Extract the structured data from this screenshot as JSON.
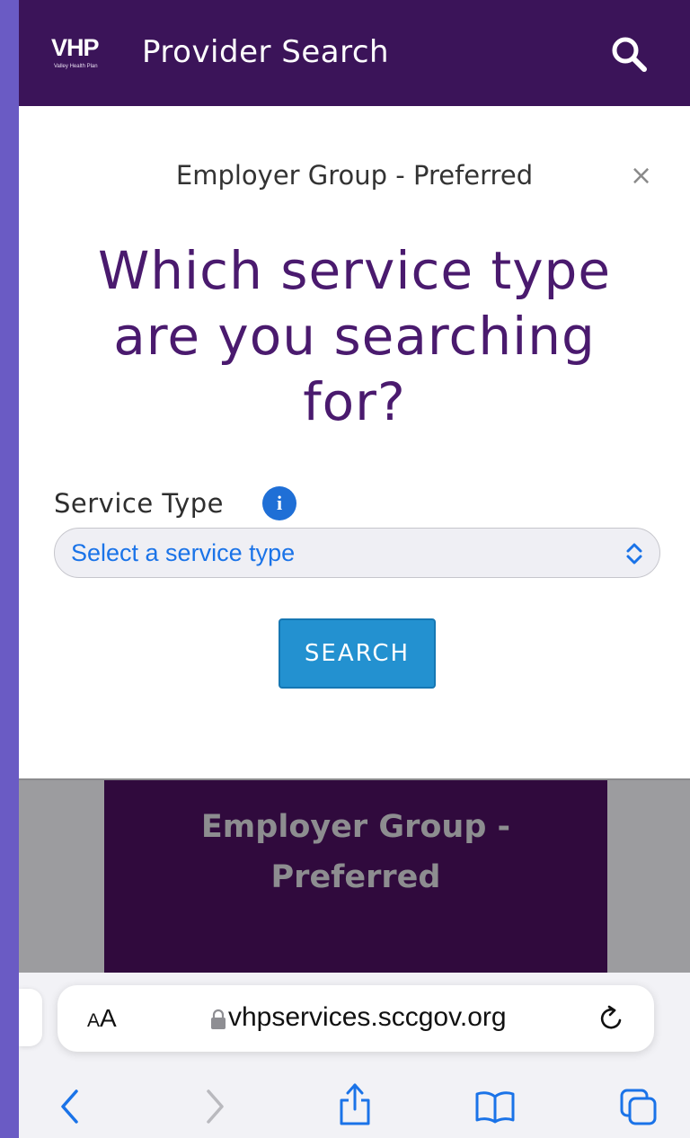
{
  "header": {
    "logo_text": "VHP",
    "logo_subtext": "Valley Health Plan",
    "title": "Provider Search"
  },
  "modal": {
    "subtitle": "Employer Group - Preferred",
    "close_glyph": "×",
    "question": "Which service type are you searching for?",
    "field_label": "Service Type",
    "info_glyph": "i",
    "select_placeholder": "Select a service type",
    "search_label": "SEARCH"
  },
  "background_banner": {
    "line1": "Employer Group -",
    "line2": "Preferred"
  },
  "browser": {
    "aa_small": "A",
    "aa_big": "A",
    "url": "vhpservices.sccgov.org"
  },
  "colors": {
    "header_bg": "#3b1459",
    "question_color": "#4a1a6e",
    "button_bg": "#2391d0",
    "link_blue": "#1a73e8"
  },
  "icons": {
    "header_search": "search-icon",
    "close": "close-icon",
    "info": "info-icon",
    "select_arrow": "chevron-updown-icon",
    "lock": "lock-icon",
    "reload": "reload-icon",
    "back": "chevron-left-icon",
    "forward": "chevron-right-icon",
    "share": "share-icon",
    "bookmarks": "book-icon",
    "tabs": "tabs-icon"
  }
}
